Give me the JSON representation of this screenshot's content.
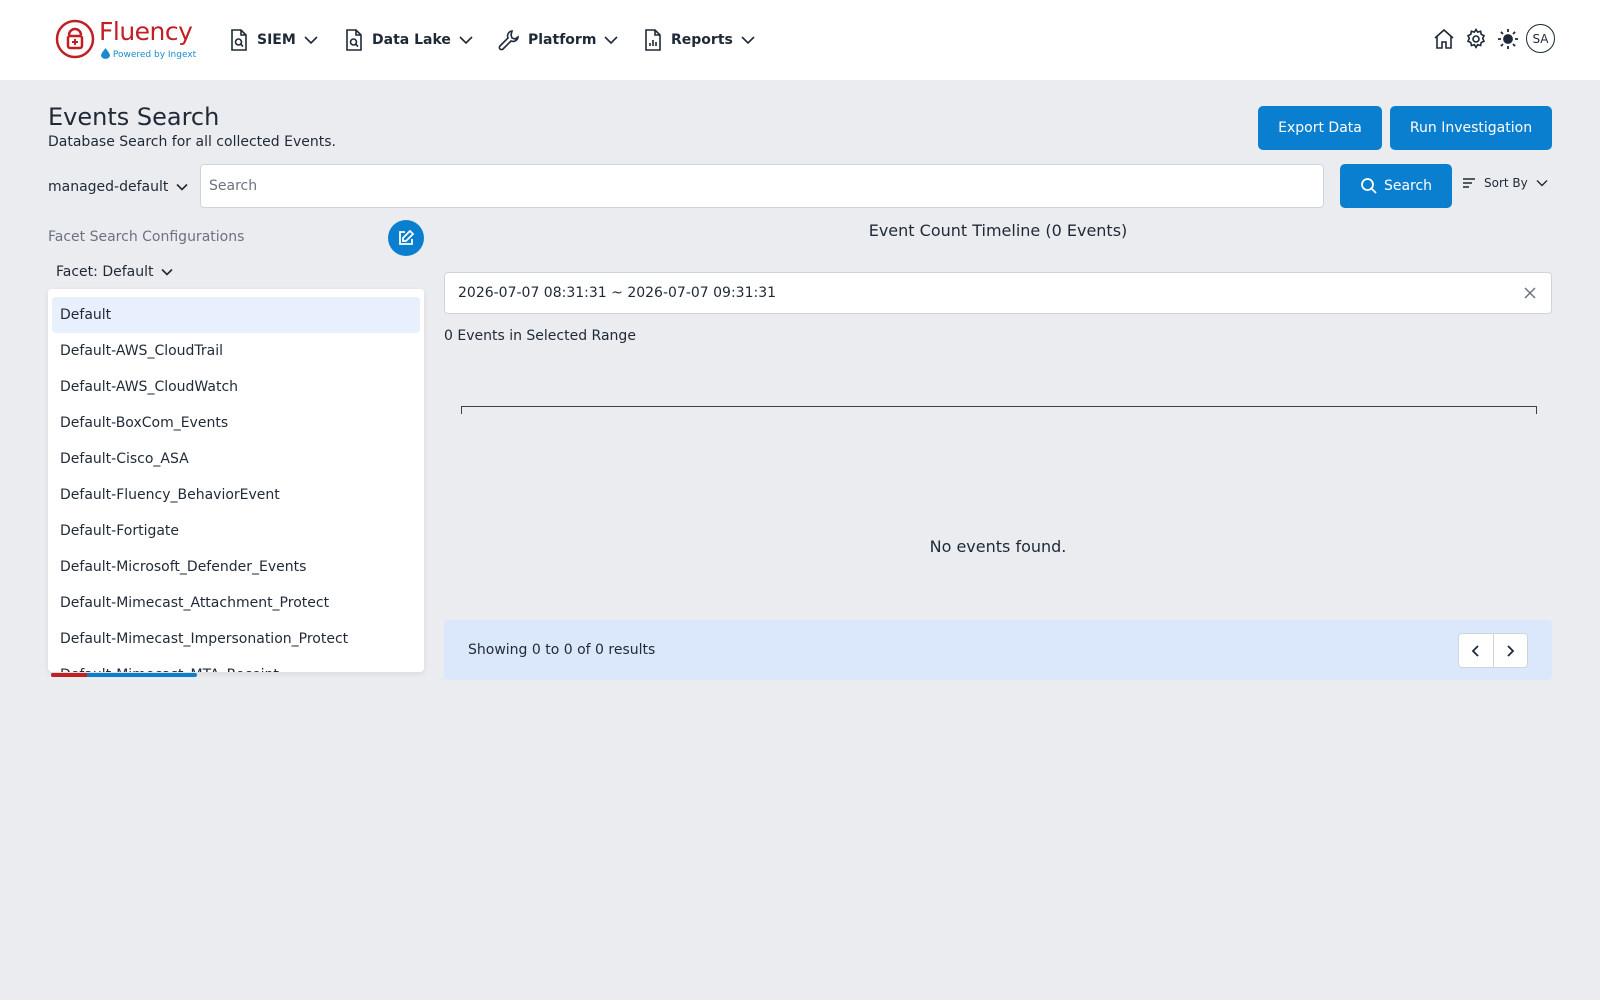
{
  "app": {
    "logo_text": "Fluency",
    "logo_subtext": "Powered by Ingext",
    "brand_color": "#c21f25",
    "accent_color": "#0b7fcf"
  },
  "nav": {
    "items": [
      {
        "label": "SIEM",
        "icon": "document-search-icon"
      },
      {
        "label": "Data Lake",
        "icon": "document-search-icon"
      },
      {
        "label": "Platform",
        "icon": "wrench-icon"
      },
      {
        "label": "Reports",
        "icon": "report-chart-icon"
      }
    ],
    "right_icons": [
      "home-icon",
      "gear-icon",
      "sun-icon"
    ],
    "avatar_initials": "SA"
  },
  "header": {
    "title": "Events Search",
    "subtitle": "Database Search for all collected Events.",
    "export_label": "Export Data",
    "investigate_label": "Run Investigation"
  },
  "search": {
    "namespace": "managed-default",
    "placeholder": "Search",
    "value": "",
    "button_label": "Search",
    "sort_label": "Sort By"
  },
  "facet": {
    "title": "Facet Search Configurations",
    "selected_label": "Facet: Default",
    "options": [
      "Default",
      "Default-AWS_CloudTrail",
      "Default-AWS_CloudWatch",
      "Default-BoxCom_Events",
      "Default-Cisco_ASA",
      "Default-Fluency_BehaviorEvent",
      "Default-Fortigate",
      "Default-Microsoft_Defender_Events",
      "Default-Mimecast_Attachment_Protect",
      "Default-Mimecast_Impersonation_Protect",
      "Default-Mimecast_MTA_Receipt"
    ]
  },
  "timeline": {
    "title": "Event Count Timeline (0 Events)",
    "range": "2026-07-07 08:31:31 ~ 2026-07-07 09:31:31",
    "range_count": "0 Events in Selected Range",
    "empty_message": "No events found."
  },
  "pager": {
    "summary": "Showing 0 to 0 of 0 results"
  }
}
